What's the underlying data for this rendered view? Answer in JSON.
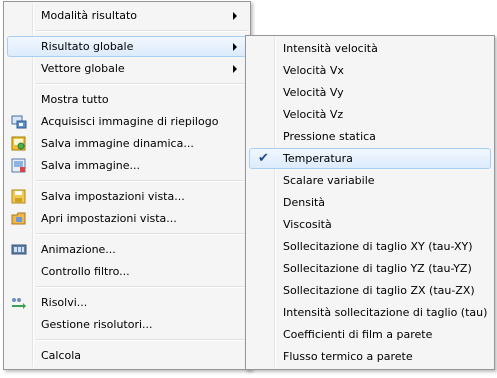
{
  "main_menu": {
    "items": [
      {
        "label": "Modalità risultato"
      },
      {
        "label": "Risultato globale"
      },
      {
        "label": "Vettore globale"
      },
      {
        "label": "Mostra tutto"
      },
      {
        "label": "Acquisisci immagine di riepilogo"
      },
      {
        "label": "Salva immagine dinamica..."
      },
      {
        "label": "Salva immagine..."
      },
      {
        "label": "Salva impostazioni vista..."
      },
      {
        "label": "Apri impostazioni vista..."
      },
      {
        "label": "Animazione..."
      },
      {
        "label": "Controllo filtro..."
      },
      {
        "label": "Risolvi..."
      },
      {
        "label": "Gestione risolutori..."
      },
      {
        "label": "Calcola"
      }
    ]
  },
  "submenu": {
    "checked_item": "Temperatura",
    "items": [
      {
        "label": "Intensità velocità"
      },
      {
        "label": "Velocità Vx"
      },
      {
        "label": "Velocità Vy"
      },
      {
        "label": "Velocità Vz"
      },
      {
        "label": "Pressione statica"
      },
      {
        "label": "Temperatura"
      },
      {
        "label": "Scalare variabile"
      },
      {
        "label": "Densità"
      },
      {
        "label": "Viscosità"
      },
      {
        "label": "Sollecitazione di taglio XY (tau-XY)"
      },
      {
        "label": "Sollecitazione di taglio YZ (tau-YZ)"
      },
      {
        "label": "Sollecitazione di taglio ZX (tau-ZX)"
      },
      {
        "label": "Intensità sollecitazione di taglio (tau)"
      },
      {
        "label": "Coefficienti di film a parete"
      },
      {
        "label": "Flusso termico a parete"
      }
    ]
  },
  "colors": {
    "menu_bg": "#f5f5f5",
    "highlight_border": "#a8d0f5",
    "highlight_fill": "#dcebfc",
    "check": "#1a4a9a"
  }
}
